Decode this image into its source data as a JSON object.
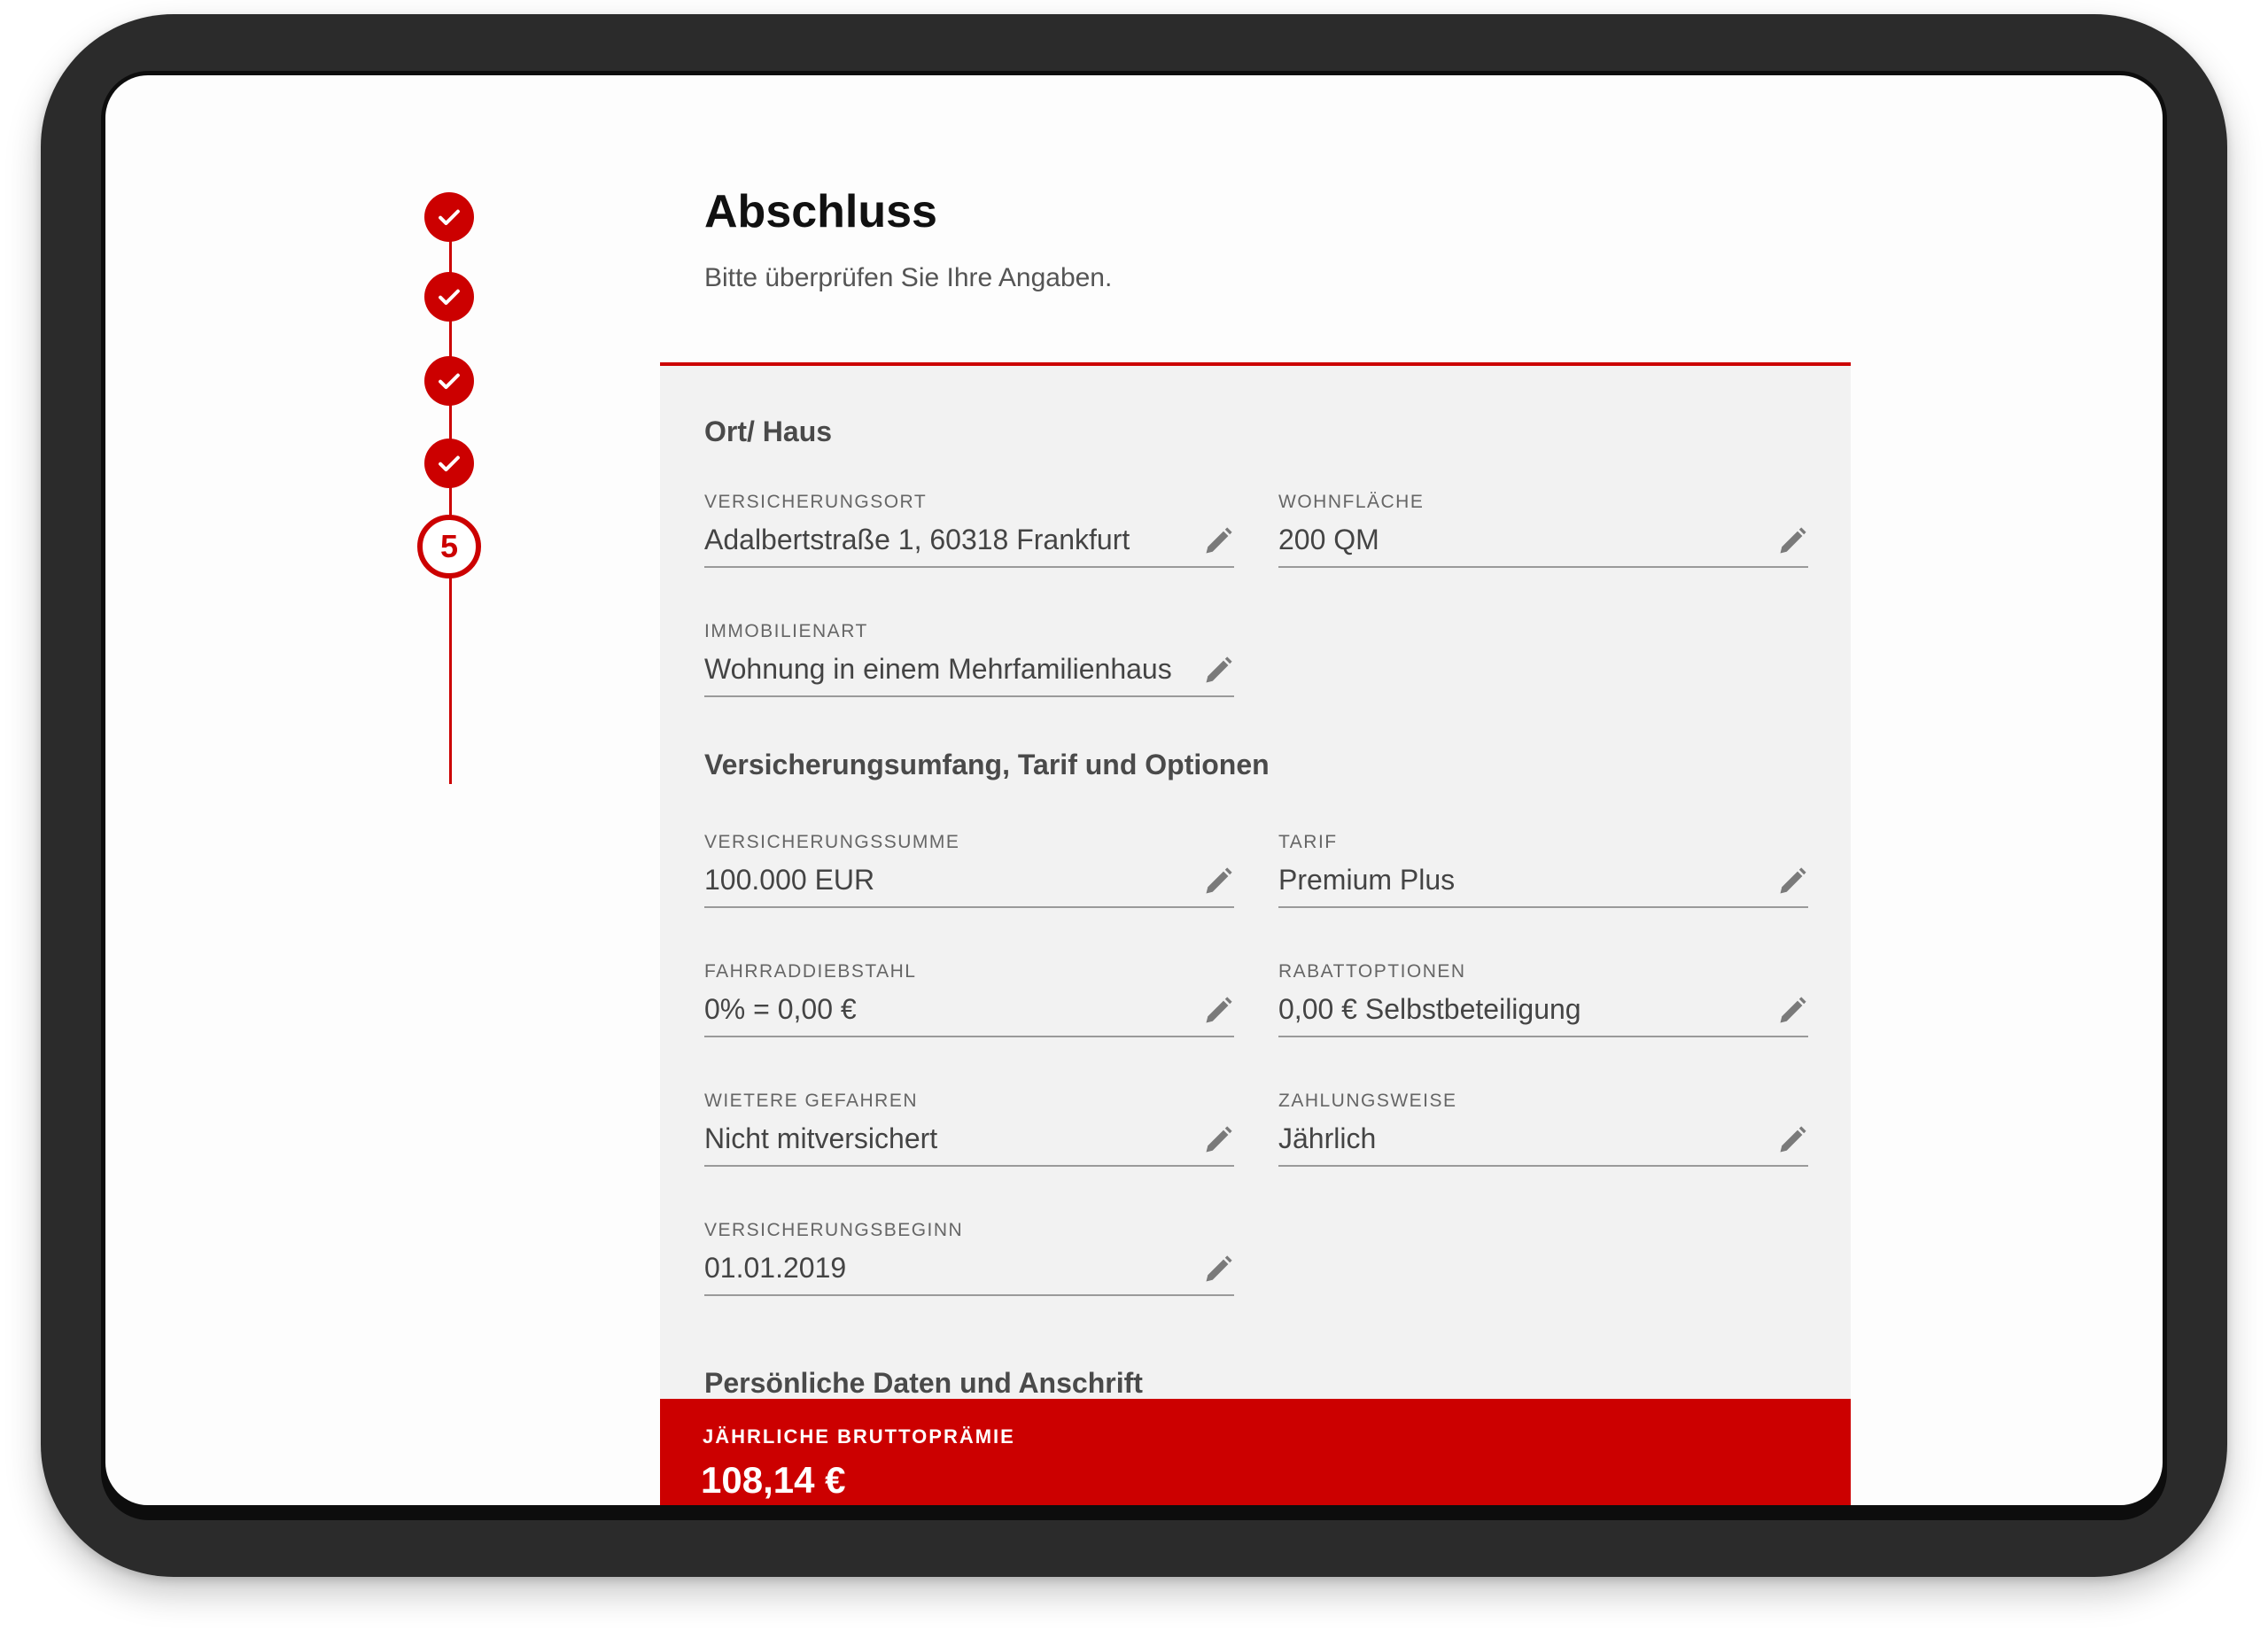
{
  "colors": {
    "accent": "#cc0000",
    "card_bg": "#f2f2f2",
    "device_frame": "#2b2b2b"
  },
  "stepper": {
    "total_steps": 5,
    "completed_steps": 4,
    "current_step_label": "5"
  },
  "header": {
    "title": "Abschluss",
    "subtitle": "Bitte überprüfen Sie Ihre Angaben."
  },
  "sections": [
    {
      "title": "Ort/ Haus",
      "fields": [
        {
          "label": "VERSICHERUNGSORT",
          "value": "Adalbertstraße 1, 60318 Frankfurt",
          "icon": "pencil-icon"
        },
        {
          "label": "WOHNFLÄCHE",
          "value": "200 QM",
          "icon": "pencil-icon"
        },
        {
          "label": "IMMOBILIENART",
          "value": "Wohnung in einem Mehrfamilienhaus",
          "icon": "pencil-icon"
        }
      ]
    },
    {
      "title": "Versicherungsumfang, Tarif und Optionen",
      "fields": [
        {
          "label": "VERSICHERUNGSSUMME",
          "value": "100.000 EUR",
          "icon": "pencil-icon"
        },
        {
          "label": "TARIF",
          "value": "Premium Plus",
          "icon": "pencil-icon"
        },
        {
          "label": "FAHRRADDIEBSTAHL",
          "value": "0% = 0,00 €",
          "icon": "pencil-icon"
        },
        {
          "label": "RABATTOPTIONEN",
          "value": "0,00 € Selbstbeteiligung",
          "icon": "pencil-icon"
        },
        {
          "label": "WIETERE GEFAHREN",
          "value": "Nicht mitversichert",
          "icon": "pencil-icon"
        },
        {
          "label": "ZAHLUNGSWEISE",
          "value": "Jährlich",
          "icon": "pencil-icon"
        },
        {
          "label": "VERSICHERUNGSBEGINN",
          "value": "01.01.2019",
          "icon": "pencil-icon"
        }
      ]
    },
    {
      "title": "Persönliche Daten und Anschrift",
      "fields": []
    }
  ],
  "premium": {
    "label": "JÄHRLICHE BRUTTOPRÄMIE",
    "value": "108,14 €"
  }
}
